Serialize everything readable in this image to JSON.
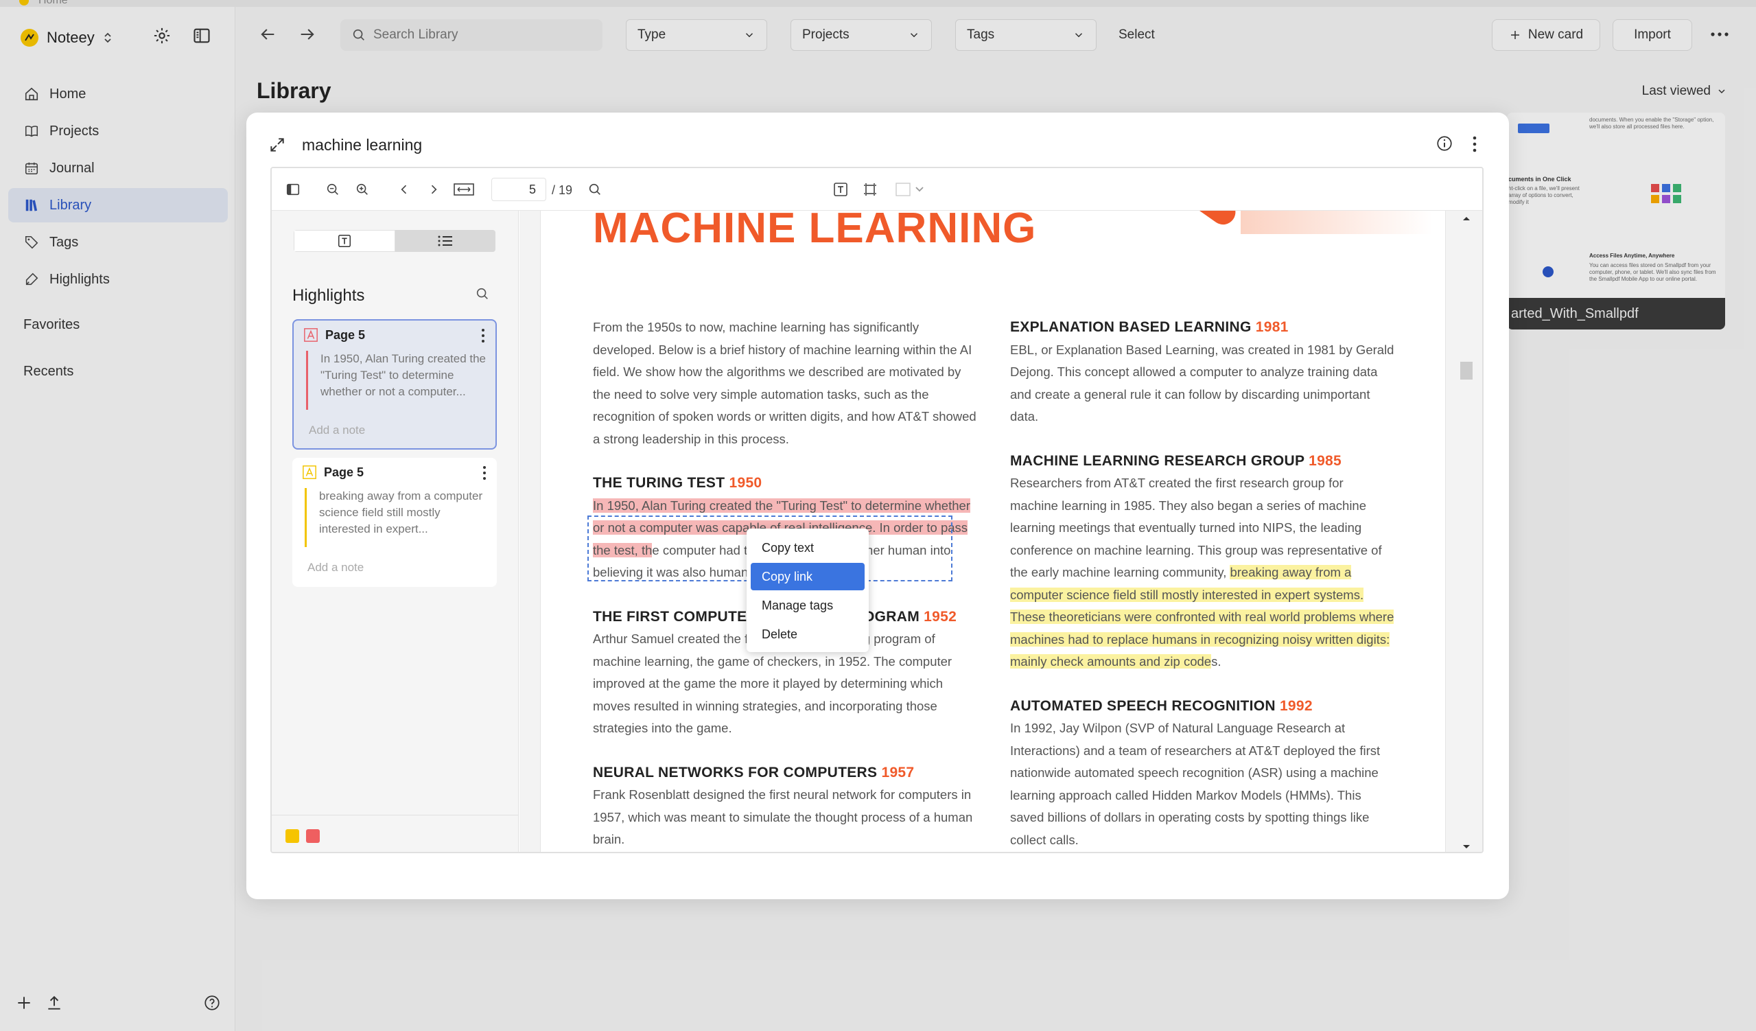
{
  "window": {
    "tab_title": "Home"
  },
  "sidebar": {
    "app_name": "Noteey",
    "items": [
      {
        "label": "Home",
        "icon": "home-icon"
      },
      {
        "label": "Projects",
        "icon": "book-icon"
      },
      {
        "label": "Journal",
        "icon": "calendar-icon"
      },
      {
        "label": "Library",
        "icon": "library-icon",
        "active": true
      },
      {
        "label": "Tags",
        "icon": "tag-icon"
      },
      {
        "label": "Highlights",
        "icon": "highlights-icon"
      }
    ],
    "sections": {
      "favorites": "Favorites",
      "recents": "Recents"
    }
  },
  "header": {
    "search_placeholder": "Search Library",
    "filters": {
      "type": "Type",
      "projects": "Projects",
      "tags": "Tags",
      "select": "Select"
    },
    "new_card": "New card",
    "import": "Import"
  },
  "library": {
    "title": "Library",
    "sort": "Last viewed",
    "background_card": {
      "caption": "arted_With_Smallpdf",
      "snippets": {
        "a": "documents. When you enable the \"Storage\" option, we'll also store all processed files here.",
        "b": "cuments in One Click",
        "c": "ht-click on a file, we'll present array of options to convert, modify it",
        "d": "Access Files Anytime, Anywhere",
        "e": "You can access files stored on Smallpdf from your computer, phone, or tablet. We'll also sync files from the Smallpdf Mobile App to our online portal."
      }
    }
  },
  "modal": {
    "title": "machine learning",
    "viewer": {
      "page_current": "5",
      "page_total": "/ 19"
    },
    "highlights_panel": {
      "title": "Highlights",
      "items": [
        {
          "page": "Page 5",
          "text": "In 1950, Alan Turing created the \"Turing Test\" to determine whether or not a computer...",
          "note_placeholder": "Add a note",
          "color": "#e8616b"
        },
        {
          "page": "Page 5",
          "text": "breaking away from a computer science field still mostly interested in expert...",
          "note_placeholder": "Add a note",
          "color": "#f2c500"
        }
      ],
      "swatches": [
        "#f6c400",
        "#ef5f60"
      ]
    },
    "document": {
      "title": "MACHINE LEARNING",
      "intro": "From the 1950s to now, machine learning has significantly developed. Below is a brief history of machine learning within the AI field. We show how the algorithms we described are motivated by the need to solve very simple automation tasks, such as the recognition of spoken words or written digits, and how AT&T showed a strong leadership in this process.",
      "left_sections": [
        {
          "heading": "THE TURING TEST",
          "year": "1950",
          "hl": "In 1950, Alan Turing created the \"Turing Test\" to determine whether or not a computer was capable of real intelligence. In order to pass the test, th",
          "rest": "e computer had to be able to fool another human into believing it was also human."
        },
        {
          "heading": "THE FIRST COMPUTER LEARNING PROGRAM",
          "year": "1952",
          "body": "Arthur Samuel created the first computer learning program of machine learning, the game of checkers, in 1952. The computer improved at the game the more it played by determining which moves resulted in winning strategies, and incorporating those strategies into the game."
        },
        {
          "heading": "NEURAL NETWORKS FOR COMPUTERS",
          "year": "1957",
          "body": "Frank Rosenblatt designed the first neural network for computers in 1957, which was meant to simulate the thought process of a human brain."
        }
      ],
      "right_sections": [
        {
          "heading": "EXPLANATION BASED LEARNING",
          "year": "1981",
          "body": "EBL, or Explanation Based Learning, was created in 1981 by Gerald Dejong. This concept allowed a computer to analyze training data and create a general rule it can follow by discarding unimportant data."
        },
        {
          "heading": "MACHINE LEARNING RESEARCH GROUP",
          "year": "1985",
          "pre": "Researchers from AT&T created the first research group for machine learning in 1985. They also began a series of machine learning meetings that eventually turned into NIPS, the leading conference on machine learning. This group was representative of the early machine learning community, ",
          "hl": "breaking away from a computer science field still mostly interested in expert systems. These theoreticians were confronted with real world problems where machines had to replace humans in recognizing noisy written digits: mainly check amounts and zip code",
          "post": "s."
        },
        {
          "heading": "AUTOMATED SPEECH RECOGNITION",
          "year": "1992",
          "body": "In 1992, Jay Wilpon (SVP of Natural Language Research at Interactions) and a team of researchers at AT&T deployed the first nationwide automated speech recognition (ASR) using a machine learning approach called Hidden Markov Models (HMMs). This saved billions of dollars in operating costs by spotting things like collect calls."
        }
      ]
    },
    "context_menu": {
      "items": [
        "Copy text",
        "Copy link",
        "Manage tags",
        "Delete"
      ],
      "hovered": "Copy link"
    }
  }
}
